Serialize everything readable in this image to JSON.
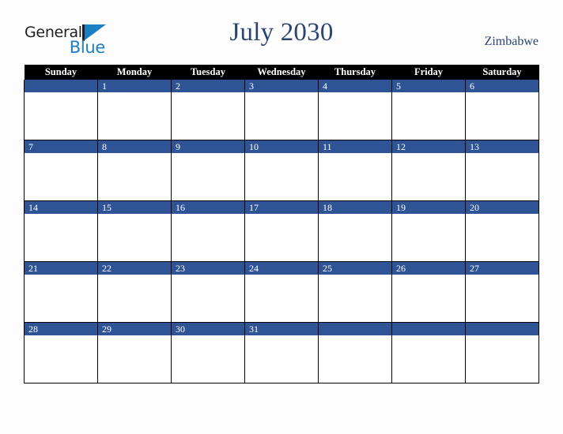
{
  "logo": {
    "word_top": "General",
    "word_bottom": "Blue",
    "dark_color": "#231f20",
    "blue_color": "#1c7fc3"
  },
  "header": {
    "title": "July 2030",
    "country": "Zimbabwe",
    "title_color": "#2b4570"
  },
  "calendar": {
    "weekday_headers": [
      "Sunday",
      "Monday",
      "Tuesday",
      "Wednesday",
      "Thursday",
      "Friday",
      "Saturday"
    ],
    "header_bg": "#000000",
    "header_text_color": "#ffffff",
    "daynum_bg": "#2f5496",
    "daynum_text_color": "#ffffff",
    "cell_bg": "#ffffff",
    "border_color": "#000000",
    "weeks": [
      [
        "",
        "1",
        "2",
        "3",
        "4",
        "5",
        "6"
      ],
      [
        "7",
        "8",
        "9",
        "10",
        "11",
        "12",
        "13"
      ],
      [
        "14",
        "15",
        "16",
        "17",
        "18",
        "19",
        "20"
      ],
      [
        "21",
        "22",
        "23",
        "24",
        "25",
        "26",
        "27"
      ],
      [
        "28",
        "29",
        "30",
        "31",
        "",
        "",
        ""
      ]
    ]
  }
}
